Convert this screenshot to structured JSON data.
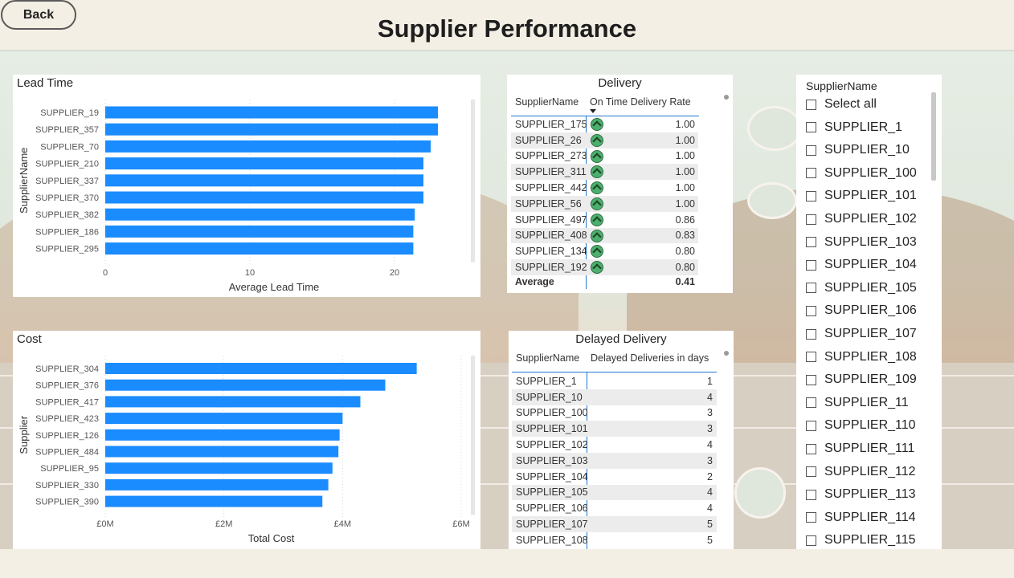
{
  "header": {
    "back_label": "Back",
    "title": "Supplier Performance"
  },
  "lead_time": {
    "title": "Lead Time",
    "chart_data": {
      "type": "bar",
      "orientation": "horizontal",
      "categories": [
        "SUPPLIER_19",
        "SUPPLIER_357",
        "SUPPLIER_70",
        "SUPPLIER_210",
        "SUPPLIER_337",
        "SUPPLIER_370",
        "SUPPLIER_382",
        "SUPPLIER_186",
        "SUPPLIER_295"
      ],
      "values": [
        23.0,
        23.0,
        22.5,
        22.0,
        22.0,
        22.0,
        21.4,
        21.3,
        21.3
      ],
      "xlabel": "Average Lead Time",
      "ylabel": "SupplierName",
      "xlim": [
        0,
        25
      ],
      "xticks": [
        "0",
        "10",
        "20"
      ],
      "xtick_values": [
        0,
        10,
        20
      ],
      "color": "#1a8cff"
    }
  },
  "cost": {
    "title": "Cost",
    "chart_data": {
      "type": "bar",
      "orientation": "horizontal",
      "categories": [
        "SUPPLIER_304",
        "SUPPLIER_376",
        "SUPPLIER_417",
        "SUPPLIER_423",
        "SUPPLIER_126",
        "SUPPLIER_484",
        "SUPPLIER_95",
        "SUPPLIER_330",
        "SUPPLIER_390"
      ],
      "values": [
        5.25,
        4.72,
        4.3,
        4.0,
        3.95,
        3.93,
        3.83,
        3.76,
        3.66
      ],
      "xlabel": "Total Cost",
      "ylabel": "Supplier",
      "unit": "M",
      "xlim": [
        0,
        6
      ],
      "xticks": [
        "£0M",
        "£2M",
        "£4M",
        "£6M"
      ],
      "xtick_values": [
        0,
        2,
        4,
        6
      ],
      "color": "#1a8cff"
    }
  },
  "delivery": {
    "title": "Delivery",
    "col1": "SupplierName",
    "col2": "On Time Delivery Rate",
    "rows": [
      {
        "name": "SUPPLIER_175",
        "value": "1.00"
      },
      {
        "name": "SUPPLIER_26",
        "value": "1.00"
      },
      {
        "name": "SUPPLIER_273",
        "value": "1.00"
      },
      {
        "name": "SUPPLIER_311",
        "value": "1.00"
      },
      {
        "name": "SUPPLIER_442",
        "value": "1.00"
      },
      {
        "name": "SUPPLIER_56",
        "value": "1.00"
      },
      {
        "name": "SUPPLIER_497",
        "value": "0.86"
      },
      {
        "name": "SUPPLIER_408",
        "value": "0.83"
      },
      {
        "name": "SUPPLIER_134",
        "value": "0.80"
      },
      {
        "name": "SUPPLIER_192",
        "value": "0.80"
      }
    ],
    "total_label": "Average",
    "total_value": "0.41",
    "row_icon": "up-arrow-circle-icon",
    "icon_color": "#4caf6e"
  },
  "delayed": {
    "title": "Delayed Delivery",
    "col1": "SupplierName",
    "col2": "Delayed Deliveries in days",
    "rows": [
      {
        "name": "SUPPLIER_1",
        "value": "1"
      },
      {
        "name": "SUPPLIER_10",
        "value": "4"
      },
      {
        "name": "SUPPLIER_100",
        "value": "3"
      },
      {
        "name": "SUPPLIER_101",
        "value": "3"
      },
      {
        "name": "SUPPLIER_102",
        "value": "4"
      },
      {
        "name": "SUPPLIER_103",
        "value": "3"
      },
      {
        "name": "SUPPLIER_104",
        "value": "2"
      },
      {
        "name": "SUPPLIER_105",
        "value": "4"
      },
      {
        "name": "SUPPLIER_106",
        "value": "4"
      },
      {
        "name": "SUPPLIER_107",
        "value": "5"
      },
      {
        "name": "SUPPLIER_108",
        "value": "5"
      }
    ]
  },
  "slicer": {
    "title": "SupplierName",
    "items": [
      "Select all",
      "SUPPLIER_1",
      "SUPPLIER_10",
      "SUPPLIER_100",
      "SUPPLIER_101",
      "SUPPLIER_102",
      "SUPPLIER_103",
      "SUPPLIER_104",
      "SUPPLIER_105",
      "SUPPLIER_106",
      "SUPPLIER_107",
      "SUPPLIER_108",
      "SUPPLIER_109",
      "SUPPLIER_11",
      "SUPPLIER_110",
      "SUPPLIER_111",
      "SUPPLIER_112",
      "SUPPLIER_113",
      "SUPPLIER_114",
      "SUPPLIER_115"
    ]
  }
}
